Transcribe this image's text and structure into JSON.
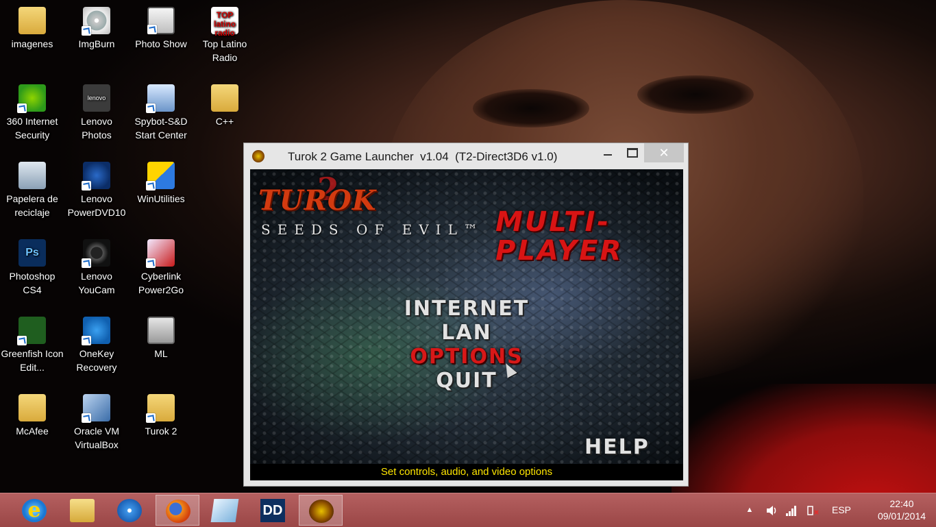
{
  "desktop": {
    "icons": [
      {
        "label": "imagenes",
        "icon": "folder-icon"
      },
      {
        "label": "ImgBurn",
        "icon": "imgburn-icon"
      },
      {
        "label": "Photo Show",
        "icon": "camera-icon"
      },
      {
        "label": "Top Latino Radio",
        "icon": "top-latino-icon",
        "logo_text": "TOP latino radio"
      },
      {
        "label": "360 Internet Security",
        "icon": "plus-shield-icon"
      },
      {
        "label": "Lenovo Photos",
        "icon": "lenovo-photos-icon",
        "logo_text": "lenovo"
      },
      {
        "label": "Spybot-S&D Start Center",
        "icon": "spybot-icon"
      },
      {
        "label": "C++",
        "icon": "folder-icon"
      },
      {
        "label": "Papelera de reciclaje",
        "icon": "recycle-bin-icon"
      },
      {
        "label": "Lenovo PowerDVD10",
        "icon": "powerdvd-icon"
      },
      {
        "label": "WinUtilities",
        "icon": "winutilities-icon"
      },
      {
        "label": "Photoshop CS4",
        "icon": "photoshop-icon",
        "logo_text": "Ps"
      },
      {
        "label": "Lenovo YouCam",
        "icon": "youcam-icon"
      },
      {
        "label": "Cyberlink Power2Go",
        "icon": "power2go-icon"
      },
      {
        "label": "Greenfish Icon Edit...",
        "icon": "greenfish-icon"
      },
      {
        "label": "OneKey Recovery",
        "icon": "onekey-icon"
      },
      {
        "label": "ML",
        "icon": "safe-icon"
      },
      {
        "label": "McAfee",
        "icon": "folder-icon"
      },
      {
        "label": "Oracle VM VirtualBox",
        "icon": "virtualbox-icon"
      },
      {
        "label": "Turok 2",
        "icon": "folder-icon"
      }
    ]
  },
  "window": {
    "title": "Turok 2 Game Launcher  v1.04  (T2-Direct3D6 v1.0)",
    "minimize_glyph": "—",
    "close_glyph": "✕",
    "game": {
      "logo": "TUROK",
      "logo_number": "2",
      "subtitle": "SEEDS OF EVIL™",
      "heading_line1": "MULTI-",
      "heading_line2": "PLAYER",
      "menu": [
        "INTERNET",
        "LAN",
        "OPTIONS",
        "QUIT"
      ],
      "active_item": "OPTIONS",
      "help": "HELP",
      "status": "Set controls, audio, and video options"
    }
  },
  "taskbar": {
    "apps": [
      {
        "name": "Internet Explorer",
        "icon": "internet-explorer-icon",
        "glyph": "e"
      },
      {
        "name": "File Explorer",
        "icon": "file-explorer-icon"
      },
      {
        "name": "Safari",
        "icon": "compass-icon"
      },
      {
        "name": "Firefox",
        "icon": "firefox-icon",
        "active": true
      },
      {
        "name": "Notepad",
        "icon": "notepad-icon"
      },
      {
        "name": "Dolby",
        "icon": "dolby-icon",
        "glyph": "DD"
      },
      {
        "name": "Turok 2 Game Launcher",
        "icon": "turok-icon",
        "active": true
      }
    ],
    "tray": {
      "show_hidden": "▲",
      "language": "ESP",
      "time": "22:40",
      "date": "09/01/2014"
    }
  }
}
